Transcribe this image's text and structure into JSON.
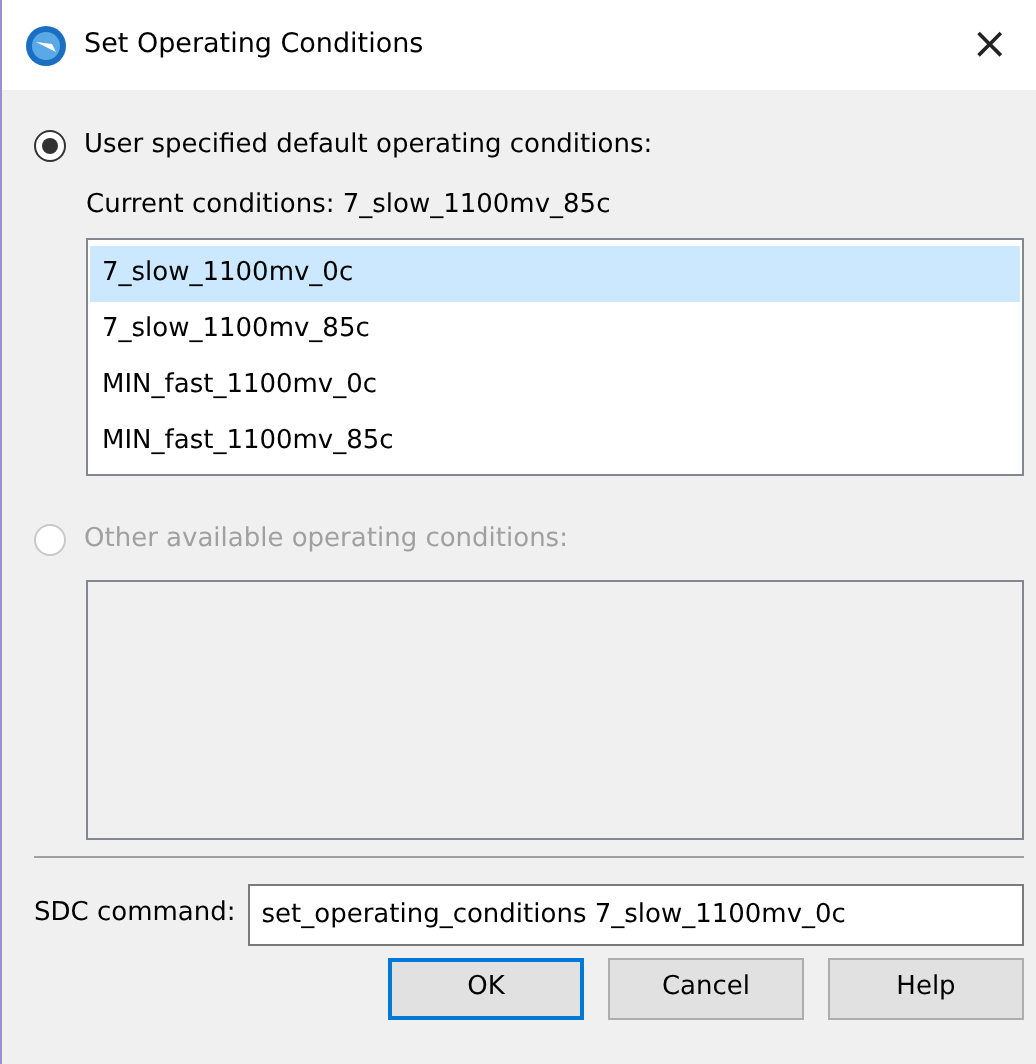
{
  "window": {
    "title": "Set Operating Conditions",
    "close": "×"
  },
  "options": [
    {
      "label": "User specified default operating conditions:",
      "selected": true,
      "disabled": false,
      "current": "Current conditions: 7_slow_1100mv_85c",
      "items": [
        {
          "label": "7_slow_1100mv_0c",
          "selected": true
        },
        {
          "label": "7_slow_1100mv_85c",
          "selected": false
        },
        {
          "label": "MIN_fast_1100mv_0c",
          "selected": false
        },
        {
          "label": "MIN_fast_1100mv_85c",
          "selected": false
        }
      ]
    },
    {
      "label": "Other available operating conditions:",
      "selected": false,
      "disabled": true
    }
  ],
  "sdc": {
    "label": "SDC command:",
    "value": "set_operating_conditions 7_slow_1100mv_0c"
  },
  "buttons": [
    {
      "label": "OK",
      "default": true
    },
    {
      "label": "Cancel",
      "default": false
    },
    {
      "label": "Help",
      "default": false
    }
  ]
}
